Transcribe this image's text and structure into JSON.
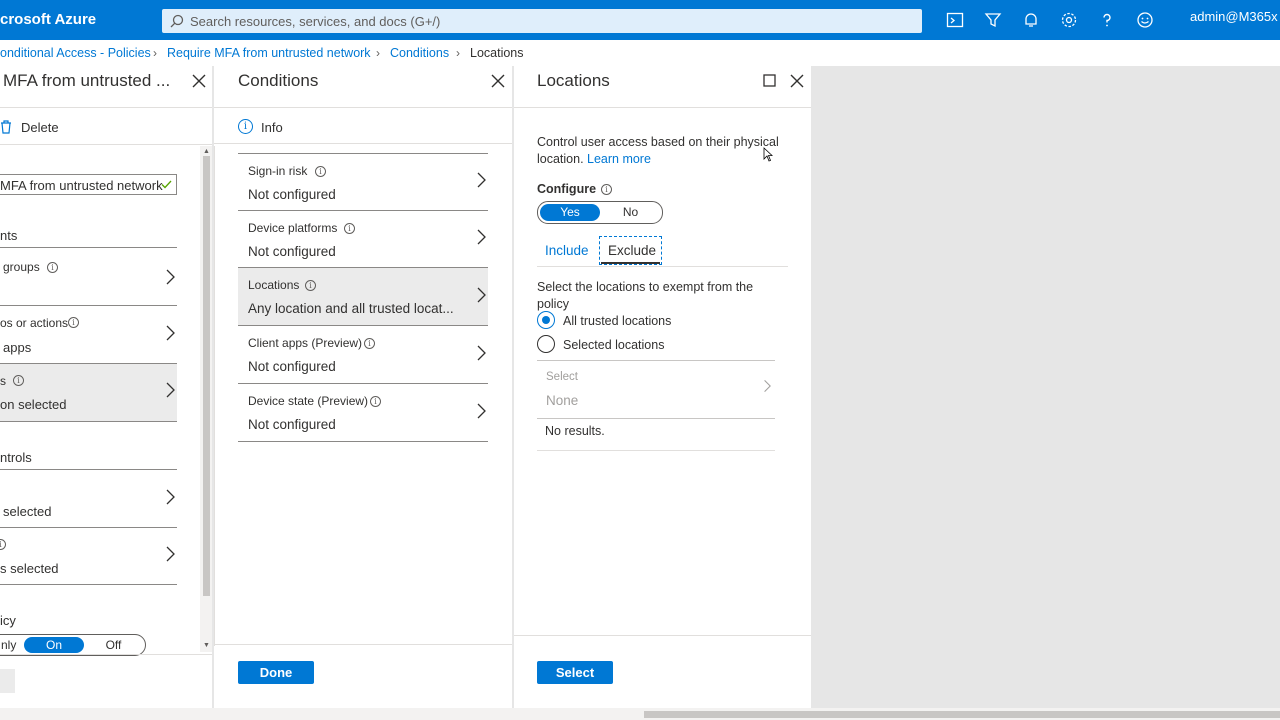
{
  "topbar": {
    "brand": "crosoft Azure",
    "search_placeholder": "Search resources, services, and docs (G+/)",
    "account": "admin@M365x",
    "icons": [
      "cloud-shell-icon",
      "directory-filter-icon",
      "notifications-icon",
      "settings-icon",
      "help-icon",
      "feedback-icon"
    ]
  },
  "breadcrumb": {
    "items": [
      "onditional Access - Policies",
      "Require MFA from untrusted network",
      "Conditions"
    ],
    "current": "Locations"
  },
  "policy_blade": {
    "title": "MFA from untrusted ...",
    "delete_label": "Delete",
    "name_value": "MFA from untrusted network",
    "assignments_heading": "nts",
    "users_label": "groups",
    "apps_label": "os or actions",
    "apps_value": "apps",
    "conditions_label": "s",
    "conditions_value": "on selected",
    "access_controls_heading": "ntrols",
    "grant_value": "selected",
    "session_value": "s selected",
    "enable_policy_label": "icy",
    "enable_report_only": "nly",
    "enable_on": "On",
    "enable_off": "Off"
  },
  "conditions_blade": {
    "title": "Conditions",
    "info_label": "Info",
    "rows": [
      {
        "label": "Sign-in risk",
        "value": "Not configured"
      },
      {
        "label": "Device platforms",
        "value": "Not configured"
      },
      {
        "label": "Locations",
        "value": "Any location and all trusted locat..."
      },
      {
        "label": "Client apps (Preview)",
        "value": "Not configured"
      },
      {
        "label": "Device state (Preview)",
        "value": "Not configured"
      }
    ],
    "done_label": "Done"
  },
  "locations_blade": {
    "title": "Locations",
    "description": "Control user access based on their physical",
    "description_line2": "location.",
    "learn_more": "Learn more",
    "configure_label": "Configure",
    "configure_yes": "Yes",
    "configure_no": "No",
    "tabs": [
      "Include",
      "Exclude"
    ],
    "active_tab": "Exclude",
    "exclude_prompt_line1": "Select the locations to exempt from the",
    "exclude_prompt_line2": "policy",
    "radio_options": [
      "All trusted locations",
      "Selected locations"
    ],
    "selected_radio": "All trusted locations",
    "select_label": "Select",
    "select_value": "None",
    "no_results": "No results.",
    "select_button": "Select"
  },
  "colors": {
    "accent": "#0078d4",
    "topbar": "#0078d4",
    "selected_row": "#ebebeb"
  }
}
